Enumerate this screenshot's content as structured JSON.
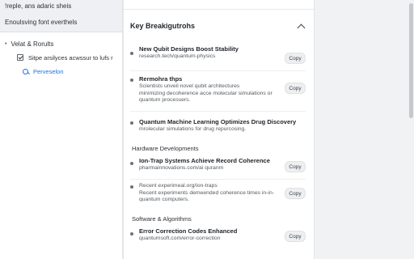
{
  "left_panel": {
    "top_line1": "!reple, ans adaric sheis",
    "top_line2": "Enoulsving font everthels",
    "section_title": "Velat & Rorults",
    "section_bullet": "•",
    "checkbox_label": "Sitpe arsilyces acwssur to lufs r",
    "search_link": "Perveselon"
  },
  "main_panel": {
    "header_title": "Key Breakigutrohs",
    "items": [
      {
        "title": "New Qubit Designs Boost Stability",
        "lines": [
          "research.tech/quantum-physics"
        ],
        "copy_label": "Copy"
      },
      {
        "title": "Rermohra thps",
        "lines": [
          "Scientists unveil novel qubit architectures",
          "minimizing decoherence acce molecular simulations or",
          "quantum processers."
        ],
        "copy_label": "Copy"
      },
      {
        "title": "Quantum Machine Learning Optimizes Drug Discovery",
        "lines": [
          "mrolecular simulations for drug repurcosing."
        ],
        "copy_label": ""
      }
    ],
    "group_hardware": "Hardware Developments",
    "hardware_items": [
      {
        "title": "Ion-Trap Systems Achieve Record Coherence",
        "lines": [
          "pharmainnovations.com/ai quranm"
        ],
        "copy_label": "Copy"
      },
      {
        "title": "",
        "lines": [
          "Recent experimeal.org/ion-traps",
          "Recent experiments demeended coherence times in-in-",
          "quantum computers."
        ],
        "copy_label": "Copy"
      }
    ],
    "group_software": "Software & Algorithms",
    "software_items": [
      {
        "title": "Error Correction Codes Enhanced",
        "lines": [
          "quantumsoft.com/error-correction"
        ],
        "copy_label": "Copy"
      }
    ]
  }
}
